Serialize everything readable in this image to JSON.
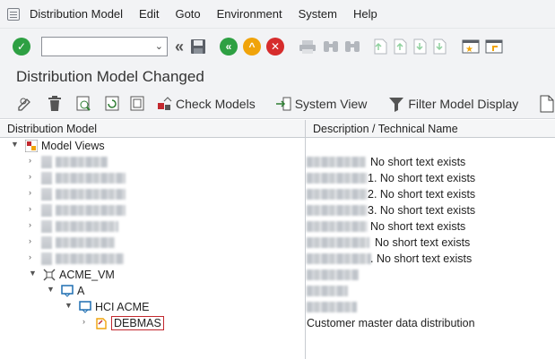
{
  "menu": [
    "Distribution Model",
    "Edit",
    "Goto",
    "Environment",
    "System",
    "Help"
  ],
  "title": "Distribution Model Changed",
  "app_toolbar": {
    "check_models": "Check Models",
    "system_view": "System View",
    "filter_display": "Filter Model Display"
  },
  "columns": {
    "left": "Distribution Model",
    "right": "Description / Technical Name"
  },
  "tree": {
    "root": "Model Views",
    "blurred_descs": [
      "No short text exists",
      "1. No short text exists",
      "2. No short text exists",
      "3. No short text exists",
      "No short text exists",
      "No short text exists",
      ". No short text exists"
    ],
    "model": "ACME_VM",
    "sender": "A",
    "receiver": "HCI ACME",
    "message": "DEBMAS",
    "message_desc": "Customer master data distribution"
  }
}
